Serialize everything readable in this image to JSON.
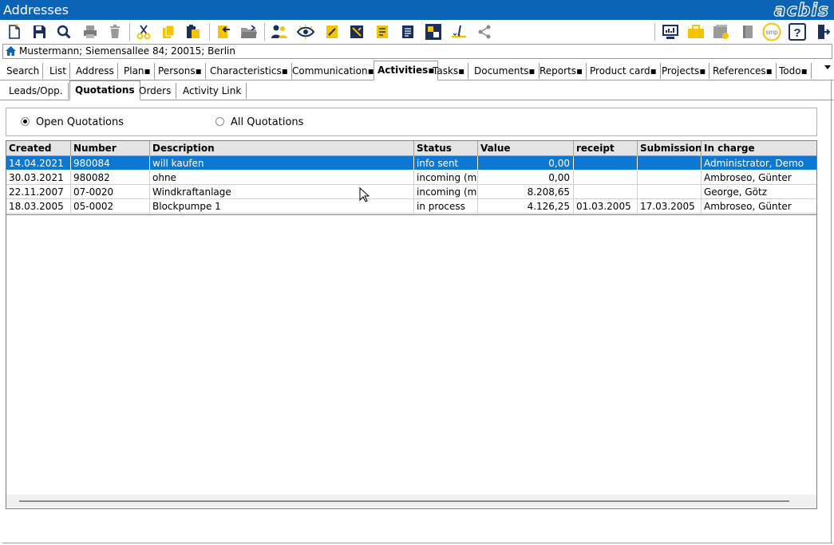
{
  "window": {
    "title": "Addresses",
    "logo": "acbis"
  },
  "toolbar": {
    "icons": [
      "new-document-icon",
      "save-icon",
      "search-icon",
      "print-icon",
      "delete-icon",
      "cut-icon",
      "copy-icon",
      "paste-icon",
      "import-icon",
      "open-folder-icon",
      "persons-icon",
      "view-icon",
      "edit-note-icon",
      "tools-icon",
      "card-icon",
      "list-document-icon",
      "layout-icon",
      "sign-icon",
      "share-icon",
      "monitor-chart-icon",
      "briefcase-icon",
      "folder-badge-icon",
      "book-icon",
      "smp-icon",
      "help-icon",
      "exit-icon"
    ],
    "smp_label": "smp",
    "help_label": "?"
  },
  "address_bar": {
    "text": "Mustermann; Siemensallee 84; 20015; Berlin"
  },
  "main_tabs": [
    "Search",
    "List",
    "Address",
    "Plan▪",
    "Persons▪",
    "Characteristics▪",
    "Communication▪",
    "Activities▪",
    "Tasks▪",
    "Documents▪",
    "Reports▪",
    "Product card▪",
    "Projects▪",
    "References▪",
    "Todo▪"
  ],
  "sub_tabs": [
    "Leads/Opp.",
    "Quotations",
    "Orders",
    "Activity Link"
  ],
  "filter": {
    "open_label": "Open Quotations",
    "all_label": "All Quotations",
    "selected": "open"
  },
  "table": {
    "columns": [
      "Created",
      "Number",
      "Description",
      "Status",
      "Value",
      "receipt",
      "Submission",
      "In charge"
    ],
    "rows": [
      [
        "14.04.2021",
        "980084",
        "will kaufen",
        "info sent",
        "0,00",
        "",
        "",
        "Administrator, Demo"
      ],
      [
        "30.03.2021",
        "980082",
        "ohne",
        "incoming (ma",
        "0,00",
        "",
        "",
        "Ambroseo, Günter"
      ],
      [
        "22.11.2007",
        "07-0020",
        "Windkraftanlage",
        "incoming (ma",
        "8.208,65",
        "",
        "",
        "George, Götz"
      ],
      [
        "18.03.2005",
        "05-0002",
        "Blockpumpe 1",
        "in process",
        "4.126,25",
        "01.03.2005",
        "17.03.2005",
        "Ambroseo, Günter"
      ]
    ],
    "selected_row": 0
  },
  "colors": {
    "titlebar": "#0b63b5",
    "selection": "#0b78d4",
    "icon_yellow": "#f5c400",
    "icon_navy": "#1a2f5a"
  }
}
